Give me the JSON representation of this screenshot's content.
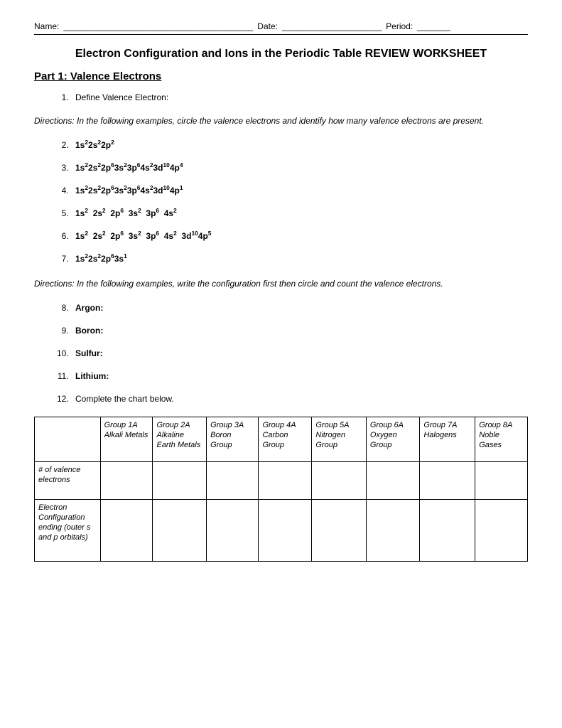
{
  "header": {
    "name_label": "Name:",
    "name_blank": "________________________________________",
    "date_label": "Date:",
    "date_blank": "_____________________",
    "period_label": "Period:",
    "period_blank": "_______"
  },
  "title": "Electron Configuration and Ions in the Periodic Table REVIEW WORKSHEET",
  "part1_heading": "Part 1: Valence Electrons",
  "q1": "Define Valence Electron:",
  "directions1": "Directions: In the following examples, circle the valence electrons and identify how many valence electrons are present.",
  "configs": {
    "q2": "1s²2s²2p²",
    "q3": "1s²2s²2p⁶3s²3p⁶4s²3d¹⁰4p⁴",
    "q4": "1s²2s²2p⁶3s²3p⁶4s²3d¹⁰4p¹",
    "q5": "1s²  2s²  2p⁶  3s²  3p⁶  4s²",
    "q6": "1s²  2s²  2p⁶  3s²  3p⁶  4s²  3d¹⁰4p⁵",
    "q7": "1s²2s²2p⁶3s¹"
  },
  "directions2": "Directions: In the following examples, write the configuration first then circle and count the valence electrons.",
  "elements": {
    "q8": "Argon:",
    "q9": "Boron:",
    "q10": "Sulfur:",
    "q11": "Lithium:"
  },
  "q12": "Complete the chart below.",
  "chart_data": {
    "type": "table",
    "columns": [
      {
        "group": "Group 1A",
        "sub": "Alkali Metals"
      },
      {
        "group": "Group 2A",
        "sub": "Alkaline Earth Metals"
      },
      {
        "group": "Group 3A",
        "sub": "Boron Group"
      },
      {
        "group": "Group 4A",
        "sub": "Carbon Group"
      },
      {
        "group": "Group 5A",
        "sub": "Nitrogen Group"
      },
      {
        "group": "Group 6A",
        "sub": "Oxygen Group"
      },
      {
        "group": "Group 7A",
        "sub": "Halogens"
      },
      {
        "group": "Group 8A",
        "sub": "Noble Gases"
      }
    ],
    "rows": [
      {
        "label": "# of valence electrons"
      },
      {
        "label": "Electron Configuration ending (outer s and p orbitals)"
      }
    ]
  }
}
